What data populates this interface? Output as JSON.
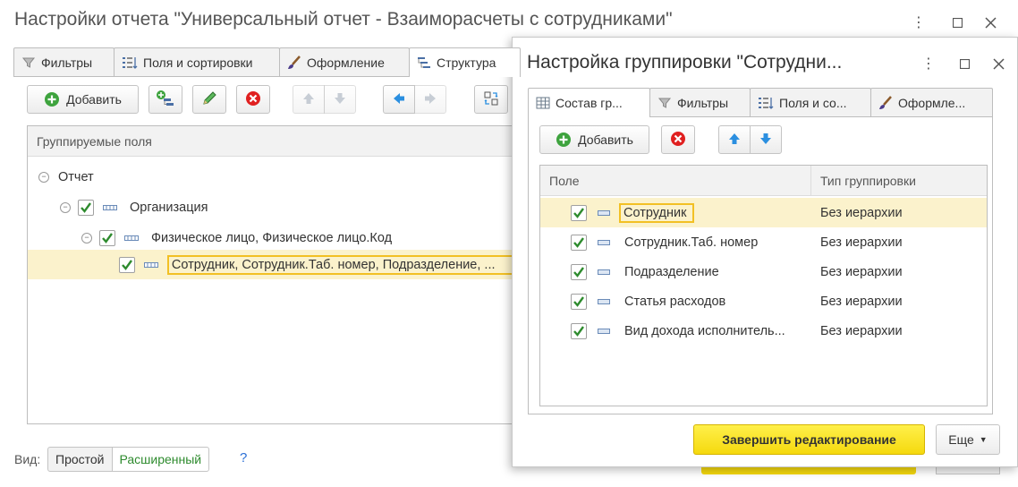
{
  "main_window": {
    "title": "Настройки отчета \"Универсальный отчет - Взаиморасчеты с сотрудниками\"",
    "tabs": [
      {
        "label": "Фильтры",
        "icon": "funnel-icon"
      },
      {
        "label": "Поля и сортировки",
        "icon": "fields-icon"
      },
      {
        "label": "Оформление",
        "icon": "brush-icon"
      },
      {
        "label": "Структура",
        "icon": "structure-icon",
        "active": true
      }
    ],
    "toolbar": {
      "add_label": "Добавить",
      "icons": [
        "add-group-icon",
        "edit-icon",
        "delete-icon",
        "move-up-icon",
        "move-down-icon",
        "move-left-icon",
        "move-right-icon",
        "regroup-icon"
      ]
    },
    "tree": {
      "header": "Группируемые поля",
      "rows": [
        {
          "label": "Отчет",
          "checked": false,
          "level": 0
        },
        {
          "label": "Организация",
          "checked": true,
          "level": 1
        },
        {
          "label": "Физическое лицо, Физическое лицо.Код",
          "checked": true,
          "level": 2
        },
        {
          "label": "Сотрудник, Сотрудник.Таб. номер, Подразделение, ...",
          "checked": true,
          "level": 3,
          "selected": true
        }
      ]
    },
    "view": {
      "label": "Вид:",
      "simple": "Простой",
      "advanced": "Расширенный",
      "help": "?"
    }
  },
  "dialog": {
    "title": "Настройка группировки \"Сотрудни...",
    "tabs": [
      {
        "label": "Состав гр...",
        "icon": "table-icon",
        "active": true
      },
      {
        "label": "Фильтры",
        "icon": "funnel-icon"
      },
      {
        "label": "Поля и со...",
        "icon": "fields-icon"
      },
      {
        "label": "Оформле...",
        "icon": "brush-icon"
      }
    ],
    "toolbar": {
      "add_label": "Добавить"
    },
    "table": {
      "columns": [
        "Поле",
        "Тип группировки"
      ],
      "rows": [
        {
          "field": "Сотрудник",
          "type": "Без иерархии",
          "checked": true,
          "selected": true
        },
        {
          "field": "Сотрудник.Таб. номер",
          "type": "Без иерархии",
          "checked": true
        },
        {
          "field": "Подразделение",
          "type": "Без иерархии",
          "checked": true
        },
        {
          "field": "Статья расходов",
          "type": "Без иерархии",
          "checked": true
        },
        {
          "field": "Вид дохода исполнитель...",
          "type": "Без иерархии",
          "checked": true
        }
      ]
    },
    "finish_label": "Завершить редактирование",
    "more_label": "Еще"
  },
  "colors": {
    "accent_yellow": "#f5d90e",
    "selection_bg": "#fbf2cc",
    "highlight_border": "#f2c024",
    "arrow": "#f07a1e",
    "check_green": "#2e8b2e"
  }
}
